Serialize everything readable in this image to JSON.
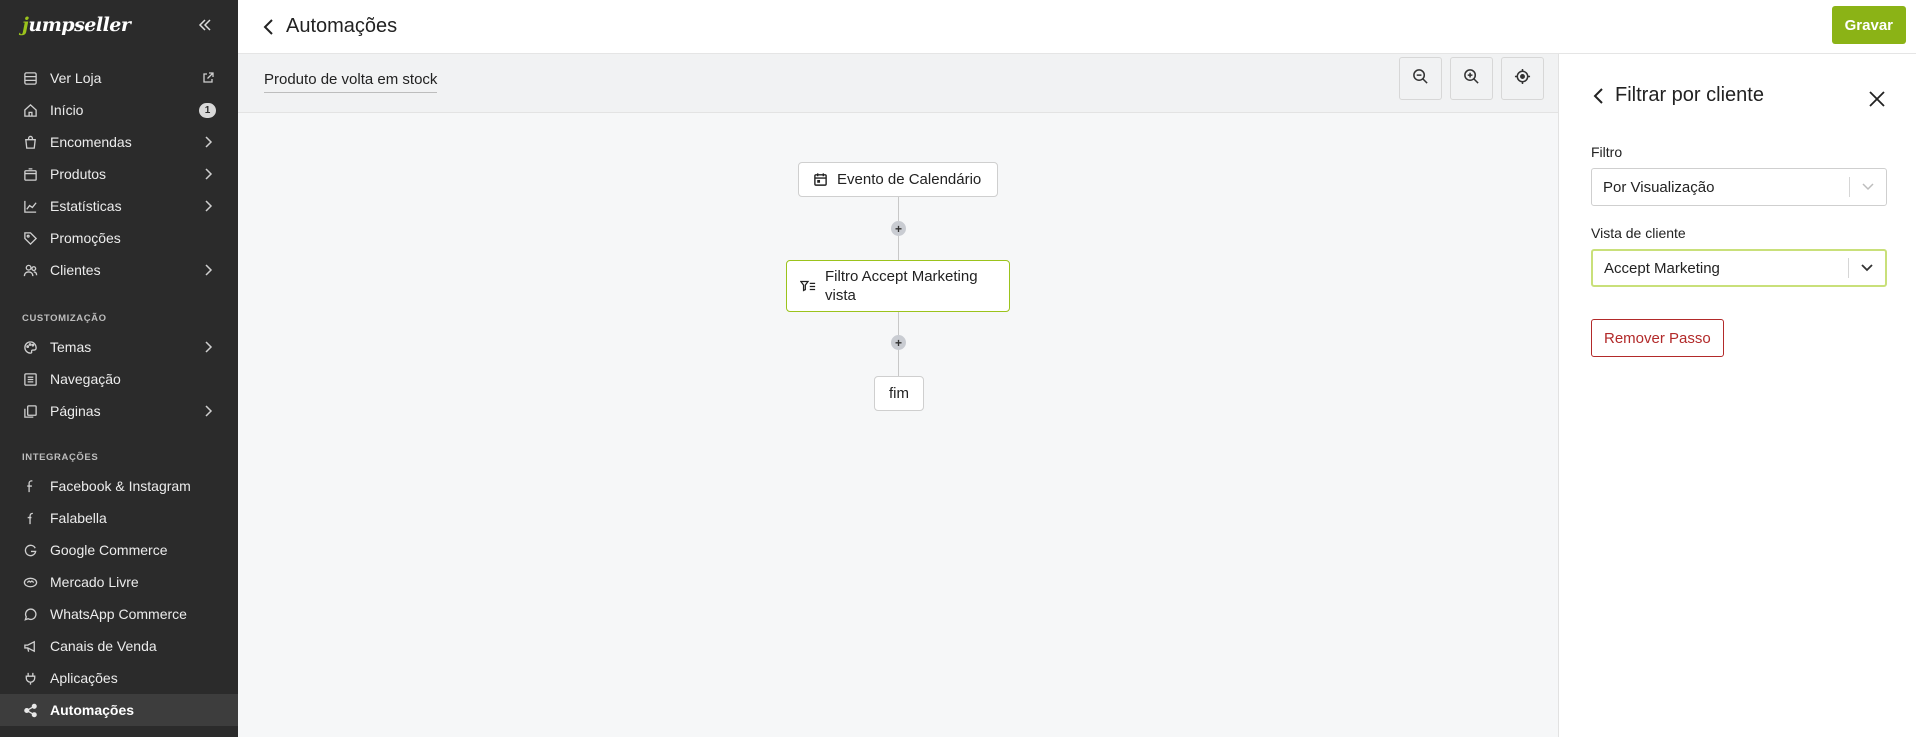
{
  "sidebar": {
    "logo": "jumpseller",
    "items_top": [
      {
        "label": "Ver Loja",
        "icon": "store-icon",
        "trail": "external-link-icon"
      },
      {
        "label": "Início",
        "icon": "home-icon",
        "badge": "1"
      },
      {
        "label": "Encomendas",
        "icon": "bag-icon",
        "trail": "chevron-right-icon"
      },
      {
        "label": "Produtos",
        "icon": "box-icon",
        "trail": "chevron-right-icon"
      },
      {
        "label": "Estatísticas",
        "icon": "chart-icon",
        "trail": "chevron-right-icon"
      },
      {
        "label": "Promoções",
        "icon": "tag-icon"
      },
      {
        "label": "Clientes",
        "icon": "users-icon",
        "trail": "chevron-right-icon"
      }
    ],
    "section_customization": "CUSTOMIZAÇÃO",
    "items_custom": [
      {
        "label": "Temas",
        "icon": "palette-icon",
        "trail": "chevron-right-icon"
      },
      {
        "label": "Navegação",
        "icon": "list-icon"
      },
      {
        "label": "Páginas",
        "icon": "pages-icon",
        "trail": "chevron-right-icon"
      }
    ],
    "section_integrations": "INTEGRAÇÕES",
    "items_integrations": [
      {
        "label": "Facebook & Instagram",
        "icon": "facebook-icon"
      },
      {
        "label": "Falabella",
        "icon": "falabella-icon"
      },
      {
        "label": "Google Commerce",
        "icon": "google-icon"
      },
      {
        "label": "Mercado Livre",
        "icon": "handshake-icon"
      },
      {
        "label": "WhatsApp Commerce",
        "icon": "whatsapp-icon"
      },
      {
        "label": "Canais de Venda",
        "icon": "megaphone-icon"
      },
      {
        "label": "Aplicações",
        "icon": "plug-icon"
      },
      {
        "label": "Automações",
        "icon": "share-icon",
        "active": true
      }
    ]
  },
  "header": {
    "title": "Automações",
    "save_label": "Gravar"
  },
  "canvas": {
    "automation_name": "Produto de volta em stock",
    "nodes": {
      "event": "Evento de Calendário",
      "filter": "Filtro Accept Marketing vista",
      "end": "fim"
    },
    "add_symbol": "+"
  },
  "panel": {
    "title": "Filtrar por cliente",
    "filter_label": "Filtro",
    "filter_value": "Por Visualização",
    "view_label": "Vista de cliente",
    "view_value": "Accept Marketing",
    "remove_label": "Remover Passo"
  },
  "colors": {
    "accent": "#8bb316",
    "sidebar_bg": "#2b2b2b",
    "danger": "#b22a2a"
  }
}
